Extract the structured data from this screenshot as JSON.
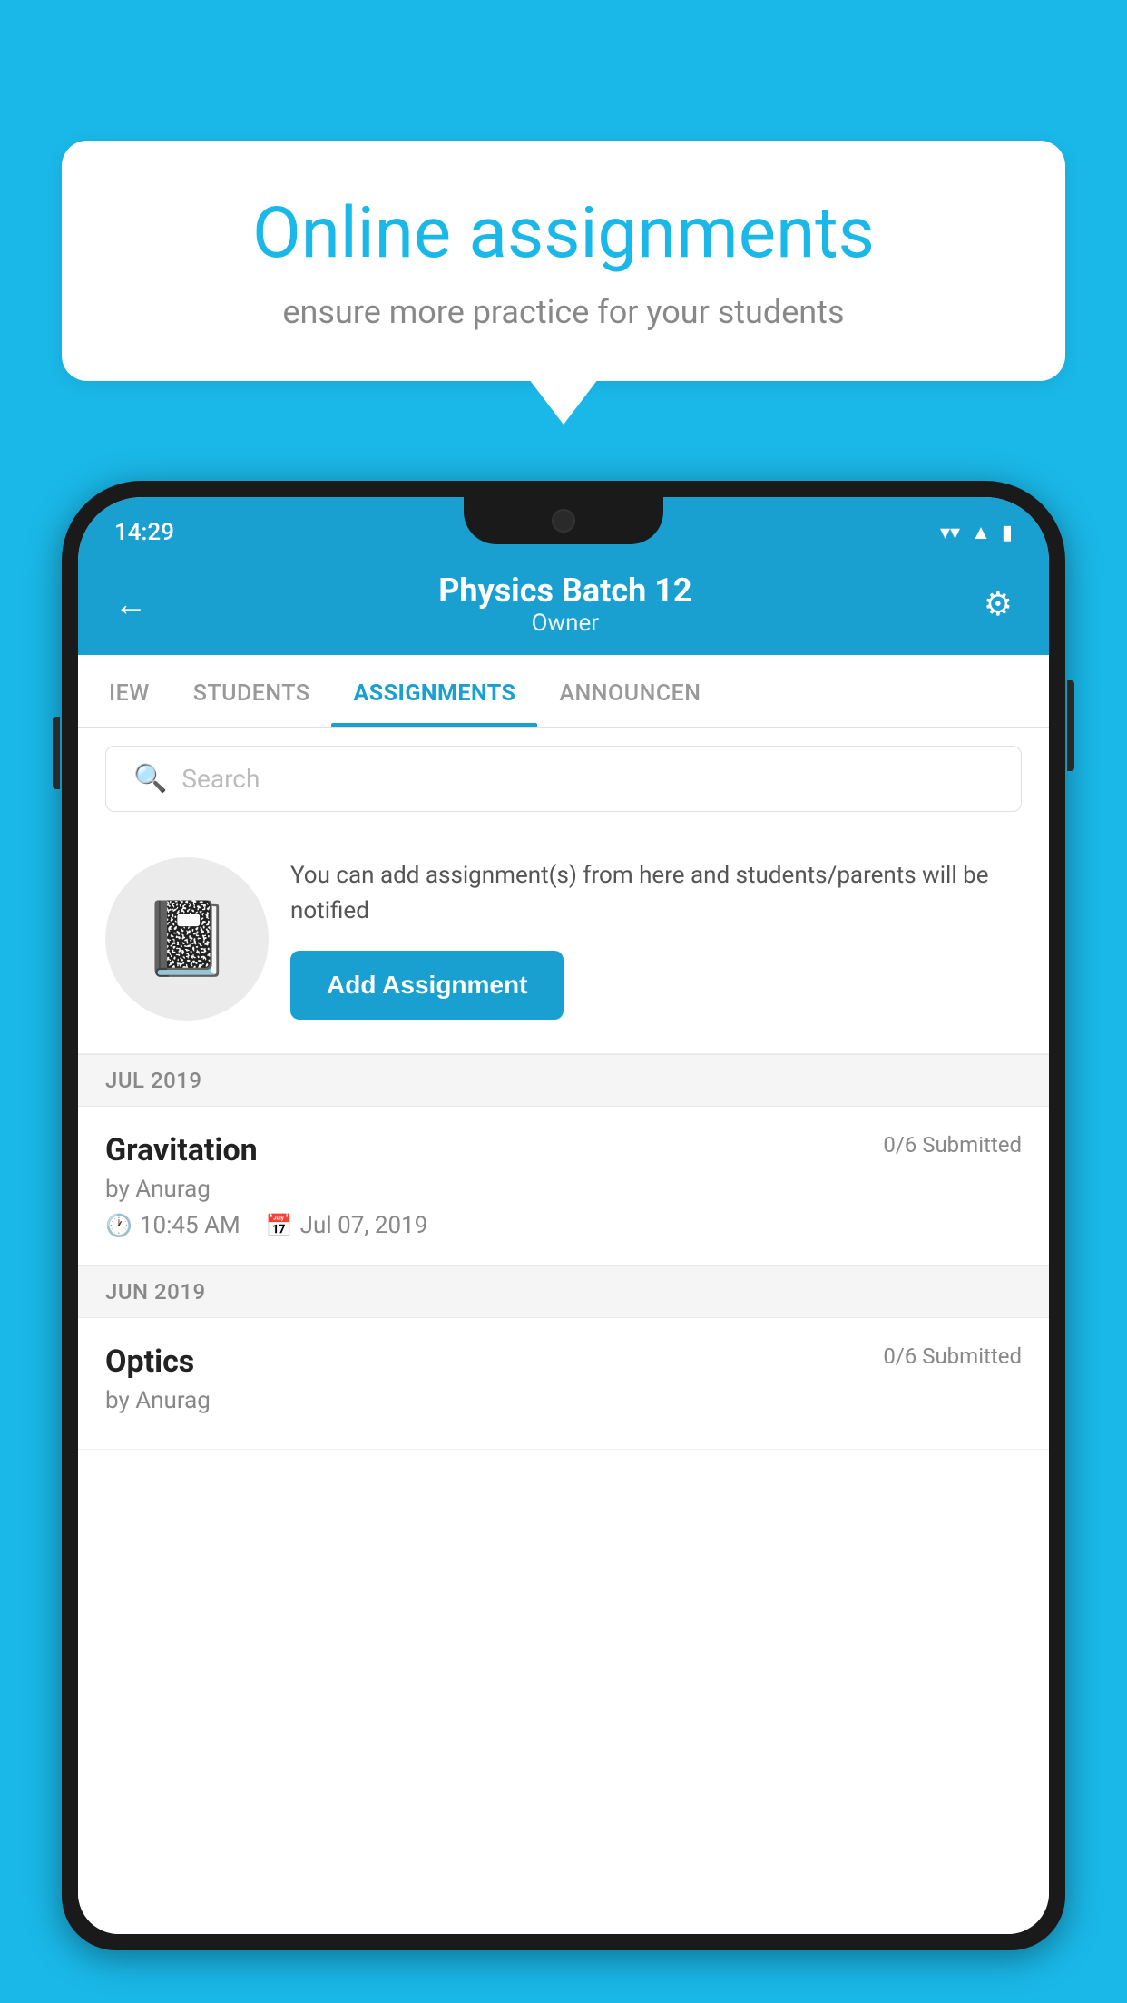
{
  "background": {
    "color": "#1ab8e8"
  },
  "speech_bubble": {
    "title": "Online assignments",
    "subtitle": "ensure more practice for your students"
  },
  "status_bar": {
    "time": "14:29",
    "wifi": "▾",
    "signal": "▲",
    "battery": "▮"
  },
  "header": {
    "title": "Physics Batch 12",
    "subtitle": "Owner",
    "back_label": "←",
    "settings_label": "⚙"
  },
  "tabs": [
    {
      "label": "IEW",
      "active": false
    },
    {
      "label": "STUDENTS",
      "active": false
    },
    {
      "label": "ASSIGNMENTS",
      "active": true
    },
    {
      "label": "ANNOUNCEN",
      "active": false
    }
  ],
  "search": {
    "placeholder": "Search"
  },
  "promo": {
    "text": "You can add assignment(s) from here and students/parents will be notified",
    "button_label": "Add Assignment"
  },
  "sections": [
    {
      "label": "JUL 2019",
      "assignments": [
        {
          "name": "Gravitation",
          "submitted": "0/6 Submitted",
          "by": "by Anurag",
          "time": "10:45 AM",
          "date": "Jul 07, 2019"
        }
      ]
    },
    {
      "label": "JUN 2019",
      "assignments": [
        {
          "name": "Optics",
          "submitted": "0/6 Submitted",
          "by": "by Anurag",
          "time": "",
          "date": ""
        }
      ]
    }
  ]
}
